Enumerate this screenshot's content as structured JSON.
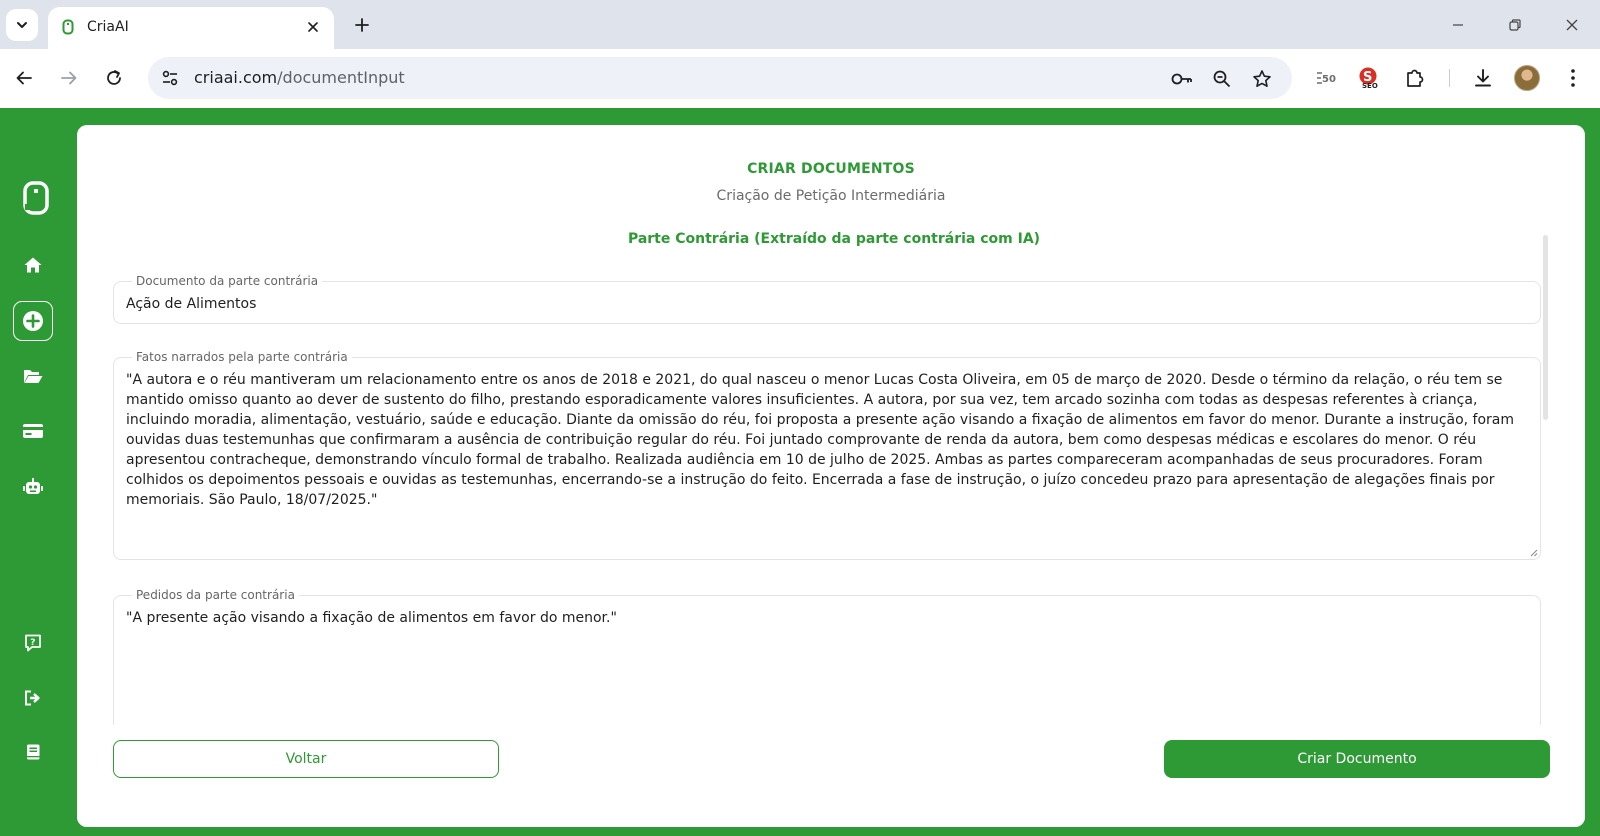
{
  "browser": {
    "tab": {
      "title": "CriaAI",
      "favicon": "criaai-favicon-icon"
    },
    "url": {
      "domain": "criaai.com",
      "path": "/documentInput"
    },
    "ext_badge": "SEO"
  },
  "colors": {
    "brand_green": "#2e9a35",
    "field_border": "#e4e4e4"
  },
  "header": {
    "title": "CRIAR DOCUMENTOS",
    "subtitle": "Criação de Petição Intermediária"
  },
  "section": {
    "title": "Parte Contrária (Extraído da parte contrária com IA)"
  },
  "fields": {
    "document": {
      "label": "Documento da parte contrária",
      "value": "Ação de Alimentos"
    },
    "facts": {
      "label": "Fatos narrados pela parte contrária",
      "value": "\"A autora e o réu mantiveram um relacionamento entre os anos de 2018 e 2021, do qual nasceu o menor Lucas Costa Oliveira, em 05 de março de 2020. Desde o término da relação, o réu tem se mantido omisso quanto ao dever de sustento do filho, prestando esporadicamente valores insuficientes. A autora, por sua vez, tem arcado sozinha com todas as despesas referentes à criança, incluindo moradia, alimentação, vestuário, saúde e educação. Diante da omissão do réu, foi proposta a presente ação visando a fixação de alimentos em favor do menor. Durante a instrução, foram ouvidas duas testemunhas que confirmaram a ausência de contribuição regular do réu. Foi juntado comprovante de renda da autora, bem como despesas médicas e escolares do menor. O réu apresentou contracheque, demonstrando vínculo formal de trabalho. Realizada audiência em 10 de julho de 2025. Ambas as partes compareceram acompanhadas de seus procuradores. Foram colhidos os depoimentos pessoais e ouvidas as testemunhas, encerrando-se a instrução do feito. Encerrada a fase de instrução, o juízo concedeu prazo para apresentação de alegações finais por memoriais. São Paulo, 18/07/2025.\""
    },
    "requests": {
      "label": "Pedidos da parte contrária",
      "value": "\"A presente ação visando a fixação de alimentos em favor do menor.\""
    }
  },
  "buttons": {
    "back": "Voltar",
    "create": "Criar Documento"
  },
  "sidebar": {
    "items": [
      {
        "name": "home",
        "icon": "home-icon"
      },
      {
        "name": "new-document",
        "icon": "plus-icon",
        "active": true
      },
      {
        "name": "documents",
        "icon": "folder-open-icon"
      },
      {
        "name": "billing",
        "icon": "credit-card-icon"
      },
      {
        "name": "assistant",
        "icon": "robot-icon"
      },
      {
        "name": "help",
        "icon": "help-icon"
      },
      {
        "name": "logout",
        "icon": "logout-icon"
      },
      {
        "name": "guide",
        "icon": "book-icon"
      }
    ]
  }
}
